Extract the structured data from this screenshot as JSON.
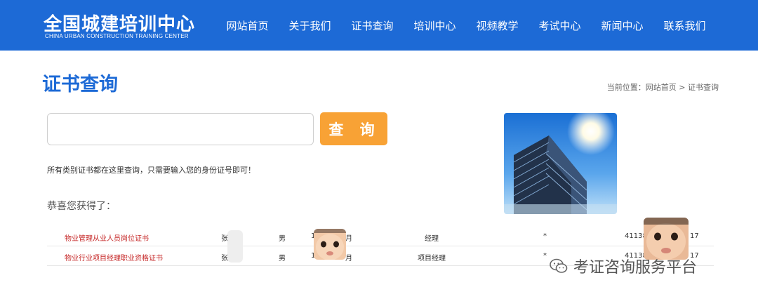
{
  "header": {
    "logo_cn": "全国城建培训中心",
    "logo_en": "CHINA URBAN CONSTRUCTION TRAINING CENTER",
    "nav": [
      "网站首页",
      "关于我们",
      "证书查询",
      "培训中心",
      "视频教学",
      "考试中心",
      "新闻中心",
      "联系我们"
    ],
    "bg_color": "#1d6ad6"
  },
  "page": {
    "title": "证书查询",
    "breadcrumb": "当前位置：网站首页 > 证书查询"
  },
  "search": {
    "value": "",
    "placeholder": "",
    "button_label": "查 询",
    "button_color": "#f8a235",
    "hint": "所有类别证书都在这里查询，只需要输入您的身份证号即可！"
  },
  "results": {
    "heading": "恭喜您获得了：",
    "rows": [
      {
        "cert": "物业管理从业人员岗位证书",
        "name": "张",
        "gender": "男",
        "date_prefix": "1",
        "date_suffix": "月",
        "position": "经理",
        "mark": "*",
        "id_prefix": "41138",
        "id_suffix": "17"
      },
      {
        "cert": "物业行业项目经理职业资格证书",
        "name": "张",
        "gender": "男",
        "date_prefix": "1",
        "date_suffix": "月",
        "position": "项目经理",
        "mark": "*",
        "id_prefix": "41138",
        "id_suffix": "17"
      }
    ]
  },
  "watermark": {
    "text": "考证咨询服务平台",
    "icon": "wechat-icon"
  }
}
